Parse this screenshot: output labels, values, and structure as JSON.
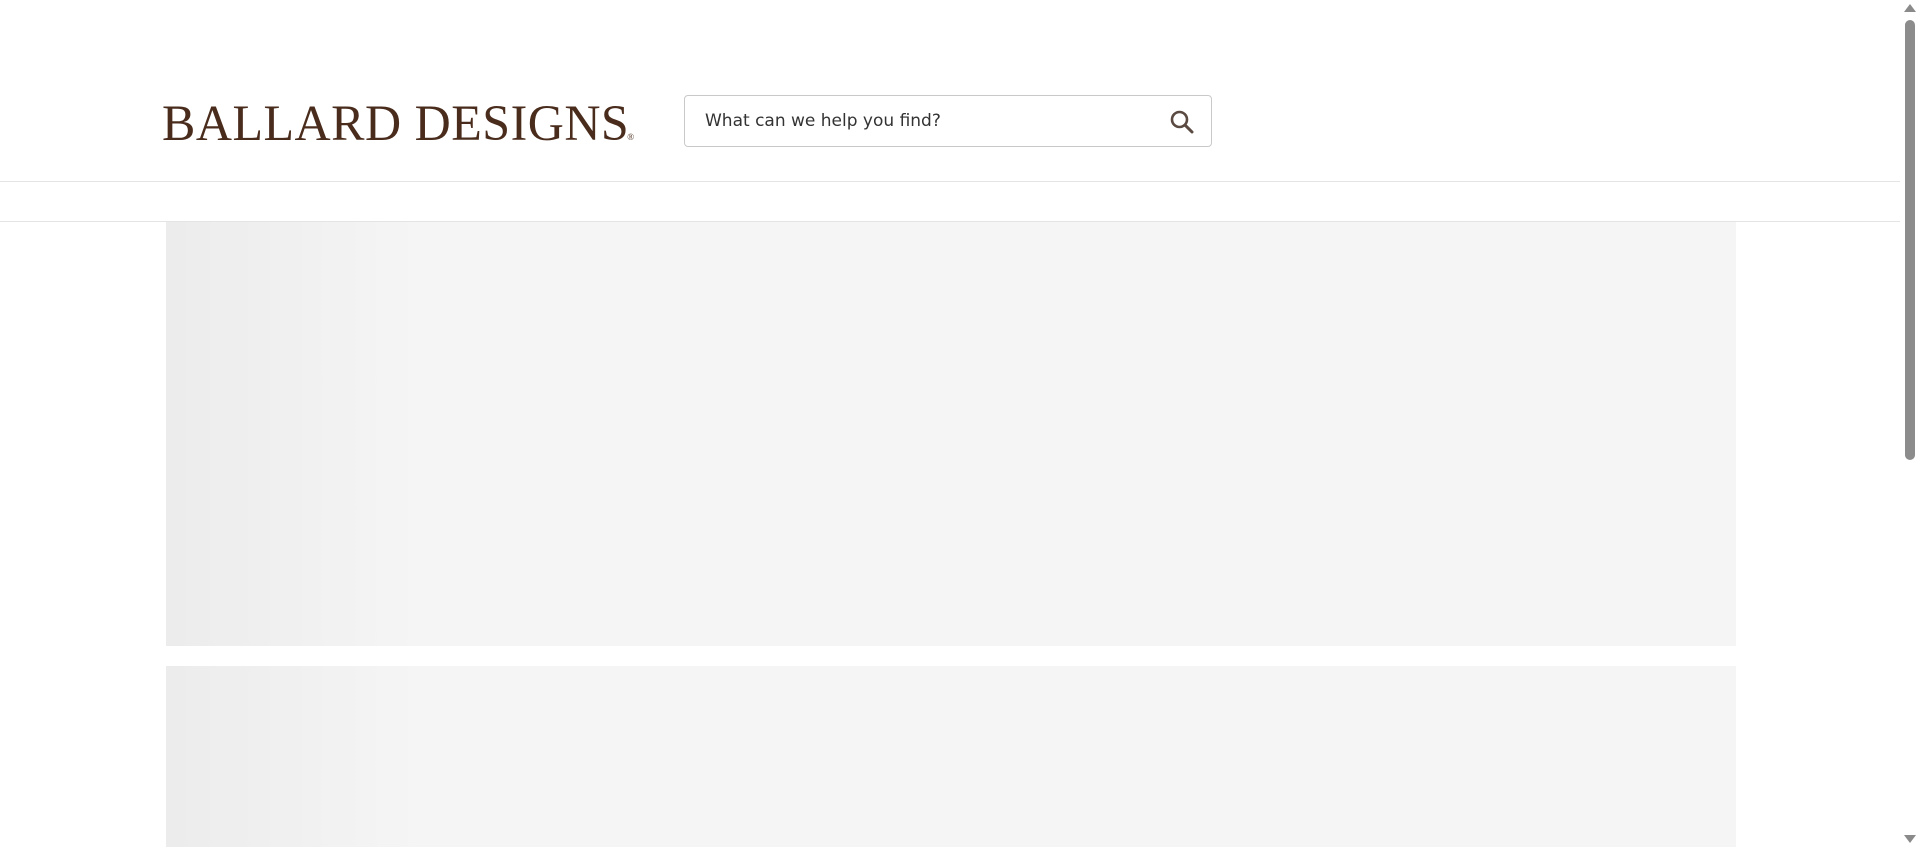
{
  "brand": {
    "logo_text": "BALLARD DESIGNS",
    "logo_mark": "®",
    "color": "#4a2c1d"
  },
  "search": {
    "placeholder": "What can we help you find?",
    "value": "",
    "icon": "search-icon"
  },
  "colors": {
    "skeleton": "#f5f5f5",
    "divider": "#e4e4e4",
    "scrollbar_thumb": "#8c8c8c"
  }
}
